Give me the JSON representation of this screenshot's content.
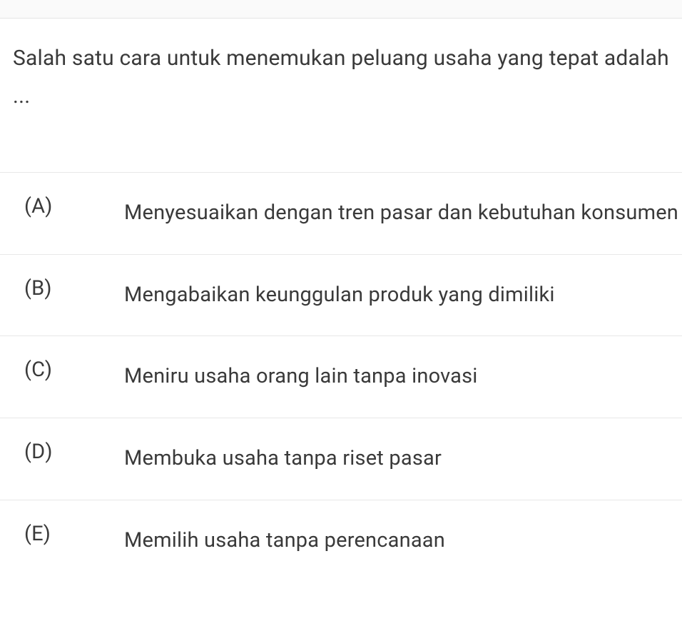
{
  "question": "Salah satu cara untuk menemukan peluang usaha yang tepat adalah ...",
  "options": [
    {
      "letter": "(A)",
      "text": "Menyesuaikan dengan tren pasar dan kebutuhan konsumen"
    },
    {
      "letter": "(B)",
      "text": "Mengabaikan keunggulan produk yang dimiliki"
    },
    {
      "letter": "(C)",
      "text": "Meniru usaha orang lain tanpa inovasi"
    },
    {
      "letter": "(D)",
      "text": "Membuka usaha tanpa riset pasar"
    },
    {
      "letter": "(E)",
      "text": "Memilih usaha tanpa perencanaan"
    }
  ]
}
